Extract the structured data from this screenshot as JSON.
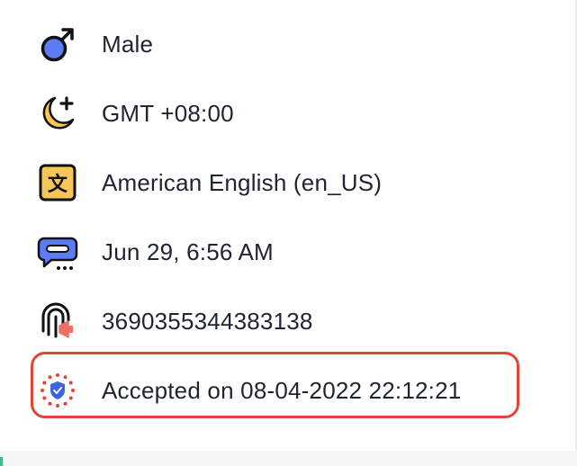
{
  "details": {
    "gender": {
      "label": "Male",
      "icon": "male-symbol-icon"
    },
    "timezone": {
      "label": "GMT +08:00",
      "icon": "moon-plus-icon"
    },
    "language": {
      "label": "American English (en_US)",
      "icon": "translate-icon"
    },
    "last_active": {
      "label": "Jun 29, 6:56 AM",
      "icon": "chat-bubble-icon"
    },
    "id": {
      "label": "3690355344383138",
      "icon": "fingerprint-megaphone-icon"
    },
    "consent": {
      "label": "Accepted on 08-04-2022 22:12:21",
      "icon": "eu-shield-icon"
    }
  },
  "colors": {
    "highlight_border": "#e0443a",
    "text": "#1f2433",
    "icon_blue": "#5b7cf5",
    "icon_yellow": "#f5c555"
  }
}
